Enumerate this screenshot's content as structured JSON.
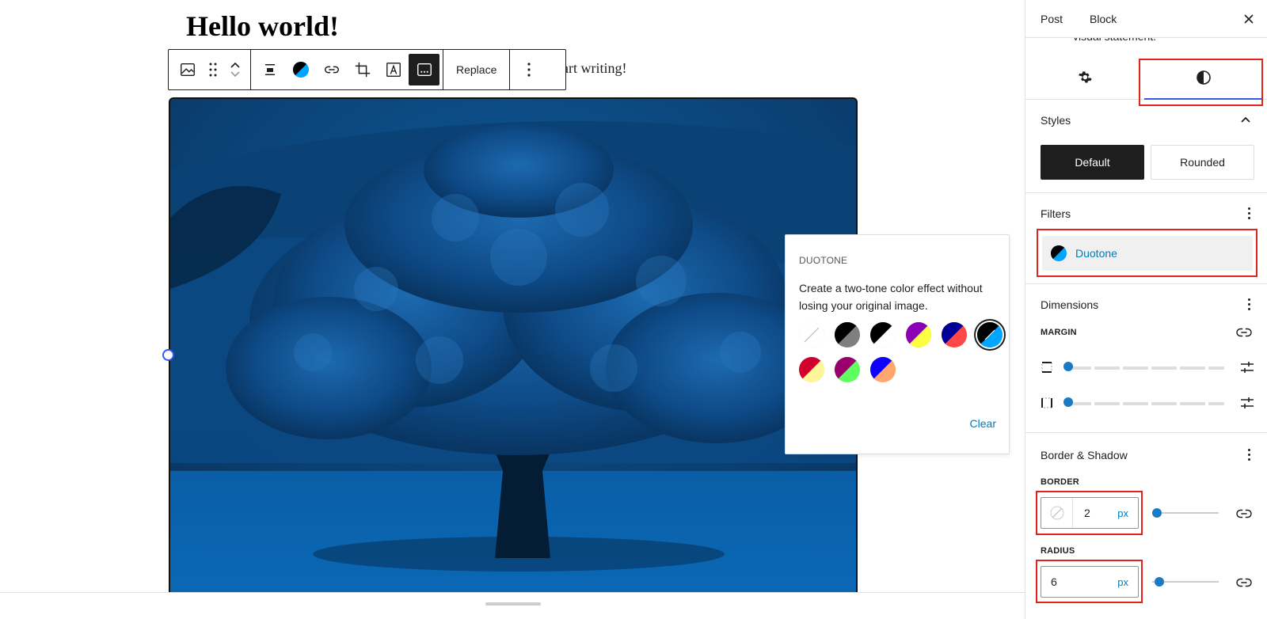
{
  "editor": {
    "post_title": "Hello world!",
    "paragraph_text_visible": "tart writing!"
  },
  "toolbar": {
    "replace_label": "Replace",
    "icons": [
      "image-icon",
      "drag-handle-icon",
      "move-up-icon",
      "move-down-icon",
      "align-icon",
      "duotone-icon",
      "link-icon",
      "crop-icon",
      "text-overlay-icon",
      "caption-icon",
      "more-options-icon"
    ]
  },
  "duotone_popover": {
    "heading": "DUOTONE",
    "description": "Create a two-tone color effect without losing your original image.",
    "clear_label": "Clear",
    "swatches": [
      {
        "c1": "#ffffff",
        "c2": "#ffffff",
        "type": "none"
      },
      {
        "c1": "#000000",
        "c2": "#7f7f7f"
      },
      {
        "c1": "#000000",
        "c2": "#ffffff"
      },
      {
        "c1": "#8c00b7",
        "c2": "#fcff41"
      },
      {
        "c1": "#000097",
        "c2": "#ff4747"
      },
      {
        "c1": "#000000",
        "c2": "#00a5ff",
        "selected": true
      },
      {
        "c1": "#d1002c",
        "c2": "#fff598"
      },
      {
        "c1": "#99006e",
        "c2": "#5eff5e"
      },
      {
        "c1": "#0c00ff",
        "c2": "#ffa56e"
      }
    ]
  },
  "sidebar": {
    "tabs": [
      "Post",
      "Block"
    ],
    "cut_text": "visual statement.",
    "styles": {
      "title": "Styles",
      "default_label": "Default",
      "rounded_label": "Rounded"
    },
    "filters": {
      "title": "Filters",
      "duotone_label": "Duotone"
    },
    "dimensions": {
      "title": "Dimensions",
      "margin_label": "MARGIN"
    },
    "border_shadow": {
      "title": "Border & Shadow",
      "border_label": "BORDER",
      "border_value": "2",
      "border_unit": "px",
      "radius_label": "RADIUS",
      "radius_value": "6",
      "radius_unit": "px"
    }
  },
  "colors": {
    "accent": "#3858e9",
    "link": "#007cba",
    "highlight_box": "#e0241c",
    "image_tint": "#0a5fa5"
  }
}
